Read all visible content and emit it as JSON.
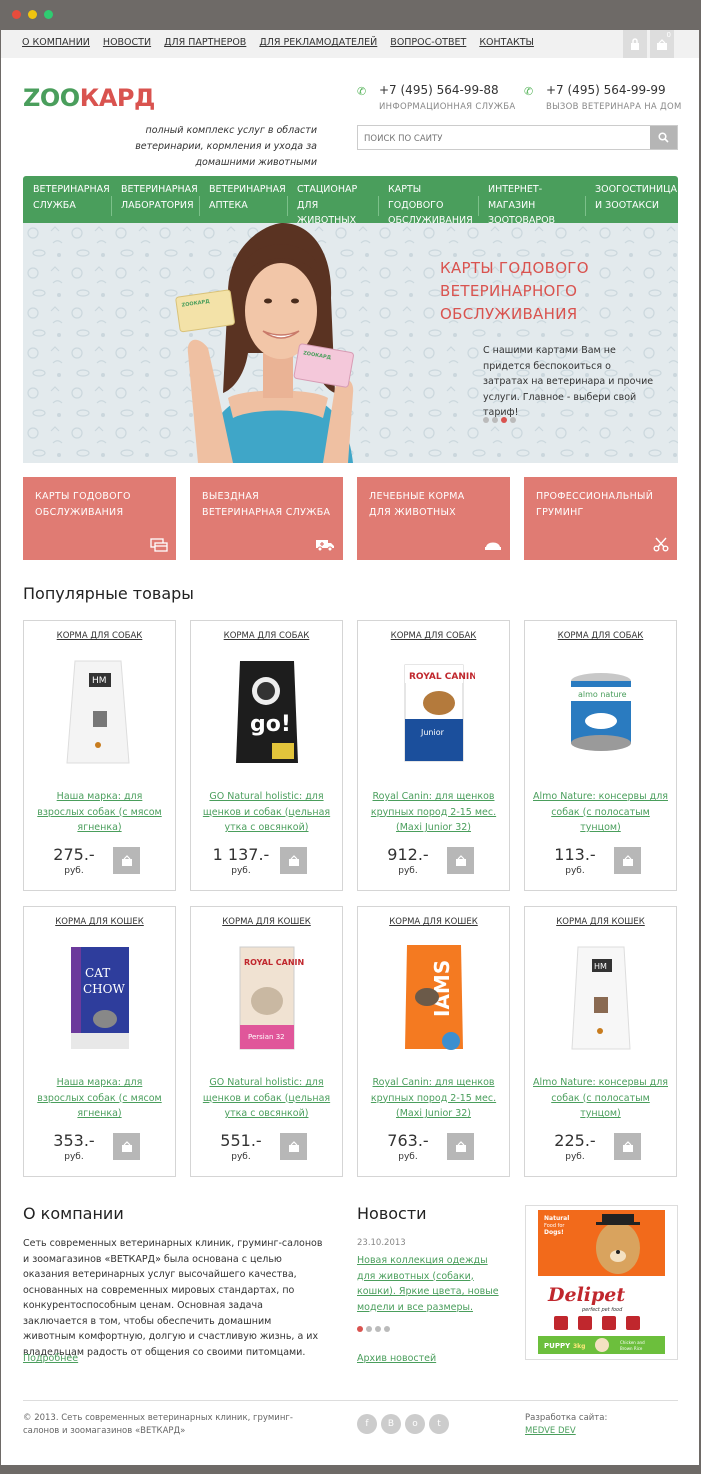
{
  "top_nav": [
    "О КОМПАНИИ",
    "НОВОСТИ",
    "ДЛЯ ПАРТНЕРОВ",
    "ДЛЯ РЕКЛАМОДАТЕЛЕЙ",
    "ВОПРОС-ОТВЕТ",
    "КОНТАКТЫ"
  ],
  "cart_count": "0",
  "logo": {
    "part1": "ZOO",
    "part2": "КАРД",
    "color1": "#4a9e5c",
    "color2": "#d9534f"
  },
  "tagline": "полный комплекс услуг в области ветеринарии, кормления и ухода за домашними животными",
  "phones": [
    {
      "number": "+7 (495) 564-99-88",
      "label": "ИНФОРМАЦИОННАЯ СЛУЖБА"
    },
    {
      "number": "+7 (495) 564-99-99",
      "label": "ВЫЗОВ ВЕТЕРИНАРА НА ДОМ"
    }
  ],
  "search": {
    "placeholder": "ПОИСК ПО САЙТУ"
  },
  "main_nav": [
    {
      "l1": "ВЕТЕРИНАРНАЯ",
      "l2": "СЛУЖБА"
    },
    {
      "l1": "ВЕТЕРИНАРНАЯ",
      "l2": "ЛАБОРАТОРИЯ"
    },
    {
      "l1": "ВЕТЕРИНАРНАЯ",
      "l2": "АПТЕКА"
    },
    {
      "l1": "СТАЦИОНАР",
      "l2": "ДЛЯ ЖИВОТНЫХ"
    },
    {
      "l1": "КАРТЫ ГОДОВОГО",
      "l2": "ОБСЛУЖИВАНИЯ"
    },
    {
      "l1": "ИНТЕРНЕТ-МАГАЗИН",
      "l2": "ЗООТОВАРОВ"
    },
    {
      "l1": "ЗООГОСТИНИЦА",
      "l2": "И ЗООТАКСИ"
    }
  ],
  "hero": {
    "title_l1": "КАРТЫ ГОДОВОГО",
    "title_l2": "ВЕТЕРИНАРНОГО",
    "title_l3": "ОБСЛУЖИВАНИЯ",
    "text": "С нашими картами Вам не придется беспокоиться о затратах на ветеринара и прочие услуги. Главное - выбери свой тариф!",
    "card_logo": "ZOOКАРД",
    "slides": 4,
    "active_slide": 3
  },
  "features": [
    {
      "l1": "КАРТЫ ГОДОВОГО",
      "l2": "ОБСЛУЖИВАНИЯ",
      "icon": "card-icon"
    },
    {
      "l1": "ВЫЕЗДНАЯ",
      "l2": "ВЕТЕРИНАРНАЯ СЛУЖБА",
      "icon": "ambulance-icon"
    },
    {
      "l1": "ЛЕЧЕБНЫЕ КОРМА",
      "l2": "ДЛЯ ЖИВОТНЫХ",
      "icon": "food-bowl-icon"
    },
    {
      "l1": "ПРОФЕССИОНАЛЬНЫЙ",
      "l2": "ГРУМИНГ",
      "icon": "scissors-icon"
    }
  ],
  "popular_title": "Популярные товары",
  "products": [
    {
      "cat": "КОРМА ДЛЯ СОБАК",
      "name": "Наша марка: для взрослых собак (с мясом ягненка)",
      "price": "275.-",
      "cur": "руб.",
      "pkg": "hm"
    },
    {
      "cat": "КОРМА ДЛЯ СОБАК",
      "name": "GO Natural holistic: для щенков и собак (цельная утка с овсянкой)",
      "price": "1 137.-",
      "cur": "руб.",
      "pkg": "go"
    },
    {
      "cat": "КОРМА ДЛЯ СОБАК",
      "name": "Royal Canin: для щенков крупных пород 2-15 мес. (Maxi Junior 32)",
      "price": "912.-",
      "cur": "руб.",
      "pkg": "rc"
    },
    {
      "cat": "КОРМА ДЛЯ СОБАК",
      "name": "Almo Nature: консервы для собак (с полосатым тунцом)",
      "price": "113.-",
      "cur": "руб.",
      "pkg": "almo"
    },
    {
      "cat": "КОРМА ДЛЯ КОШЕК",
      "name": "Наша марка: для взрослых собак (с мясом ягненка)",
      "price": "353.-",
      "cur": "руб.",
      "pkg": "catchow"
    },
    {
      "cat": "КОРМА ДЛЯ КОШЕК",
      "name": "GO Natural holistic: для щенков и собак (цельная утка с овсянкой)",
      "price": "551.-",
      "cur": "руб.",
      "pkg": "rcpersian"
    },
    {
      "cat": "КОРМА ДЛЯ КОШЕК",
      "name": "Royal Canin: для щенков крупных пород 2-15 мес. (Maxi Junior 32)",
      "price": "763.-",
      "cur": "руб.",
      "pkg": "iams"
    },
    {
      "cat": "КОРМА ДЛЯ КОШЕК",
      "name": "Almo Nature: консервы для собак (с полосатым тунцом)",
      "price": "225.-",
      "cur": "руб.",
      "pkg": "hm2"
    }
  ],
  "about": {
    "title": "О компании",
    "text": "Сеть современных ветеринарных клиник, груминг-салонов и зоомагазинов «ВЕТКАРД» была основана с целью оказания ветеринарных услуг высочайшего качества, основанных на современных мировых стандартах, по конкурентоспособным ценам. Основная задача заключается в том, чтобы обеспечить домашним животным комфортную, долгую и счастливую жизнь, а их владельцам радость от общения со своими питомцами.",
    "more": "Подробнее"
  },
  "news": {
    "title": "Новости",
    "date": "23.10.2013",
    "text": "Новая коллекция одежды для животных (собаки, кошки). Яркие цвета, новые модели и все размеры.",
    "archive": "Архив новостей"
  },
  "banner": {
    "natural": "Natural Food for Dogs!",
    "brand": "Delipet",
    "slogan": "perfect pet food",
    "puppy": "PUPPY",
    "weight": "3kg",
    "flavor": "Chicken and Brown Rice"
  },
  "footer": {
    "copyright": "© 2013. Сеть современных ветеринарных клиник, груминг-салонов и зоомагазинов «ВЕТКАРД»",
    "dev_label": "Разработка сайта:",
    "dev_link": "MEDVE DEV",
    "social": [
      "f",
      "B",
      "о",
      "t"
    ]
  }
}
